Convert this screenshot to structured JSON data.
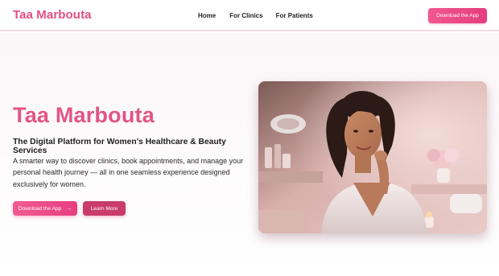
{
  "header": {
    "brand": "Taa Marbouta",
    "nav": [
      "Home",
      "For Clinics",
      "For Patients"
    ],
    "download_label": "Download the App"
  },
  "hero": {
    "title": "Taa Marbouta",
    "subtitle": "The Digital Platform for Women's Healthcare & Beauty Services",
    "description": "A smarter way to discover clinics, book appointments, and manage your personal health journey — all in one seamless experience designed exclusively for women.",
    "primary_button": "Download the App",
    "primary_icon": "arrow-right-icon",
    "secondary_button": "Learn More"
  },
  "colors": {
    "brand": "#e24d84",
    "primary_button": "#e63f80",
    "secondary_button": "#c83b6a"
  }
}
